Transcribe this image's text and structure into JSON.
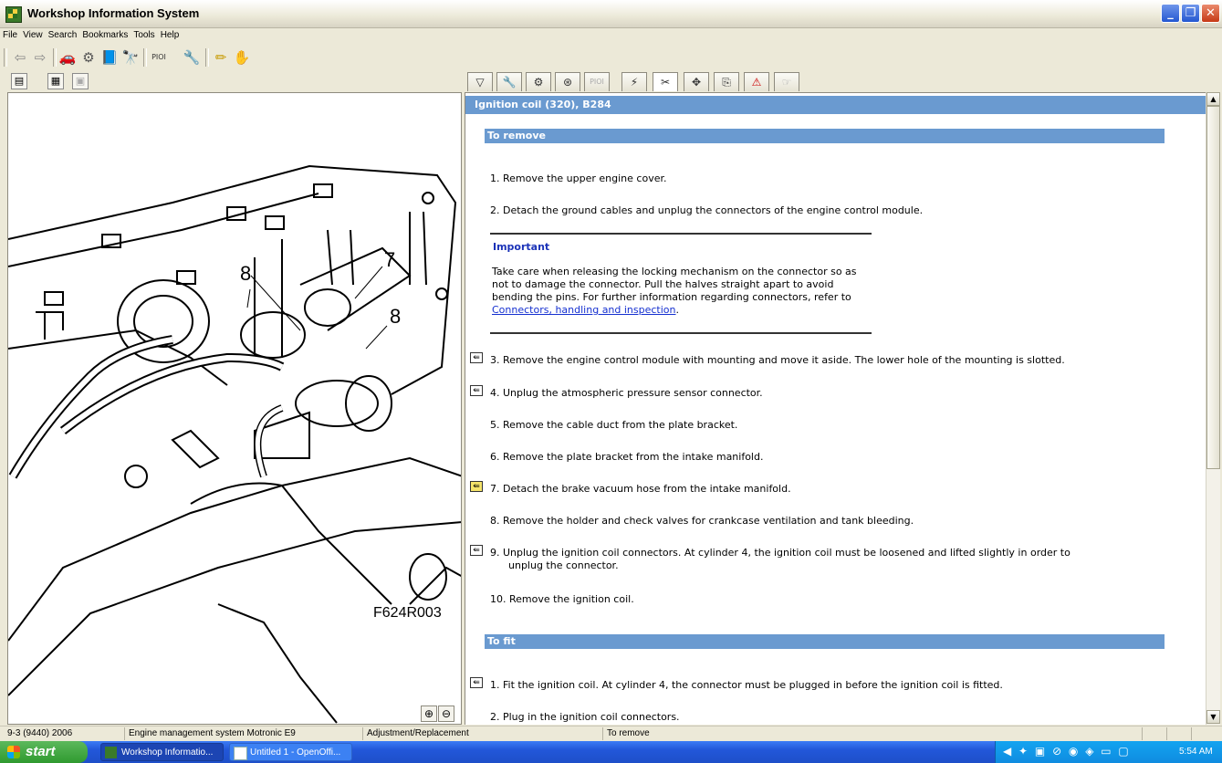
{
  "window": {
    "title": "Workshop Information System",
    "controls": {
      "minimize": "_",
      "maximize": "❐",
      "close": "✕"
    }
  },
  "menu": [
    "File",
    "View",
    "Search",
    "Bookmarks",
    "Tools",
    "Help"
  ],
  "toolbar": {
    "items": [
      "back-arrow-icon",
      "forward-arrow-icon",
      "car-icon",
      "chassis-icon",
      "book-icon",
      "binoculars-icon",
      "pi-icon",
      "wrench-tool-icon",
      "pencil-icon",
      "bell-icon"
    ],
    "pi_label": "PIOI"
  },
  "left_tabs": [
    "tree-view-icon",
    "document-view-icon",
    "image-view-icon"
  ],
  "right_tabs": [
    "triangle-icon",
    "wrench-icon",
    "engine-icon",
    "gear-icon",
    "pi-icon",
    "spark-icon",
    "tools-icon",
    "move-icon",
    "steps-icon",
    "warning-icon",
    "arrow-icon"
  ],
  "right_tabs_pi_label": "PIOI",
  "illustration": {
    "code": "F624R003",
    "callouts": [
      "8",
      "7",
      "8"
    ]
  },
  "zoom": {
    "in": "⊕",
    "out": "⊖"
  },
  "document": {
    "title": "Ignition coil (320), B284",
    "remove_heading": "To remove",
    "steps": [
      "1.  Remove the upper engine cover.",
      "2.  Detach the ground cables and unplug the connectors of the engine control module.",
      "3.  Remove the engine control module with mounting and move it aside. The lower hole of the mounting is slotted.",
      "4.  Unplug the atmospheric pressure sensor connector.",
      "5.  Remove the cable duct from the plate bracket.",
      "6.  Remove the plate bracket from the intake manifold.",
      "7.  Detach the brake vacuum hose from the intake manifold.",
      "8.  Remove the holder and check valves for crankcase ventilation and tank bleeding.",
      "9.  Unplug the ignition coil connectors. At cylinder 4, the ignition coil must be loosened and lifted slightly in order to",
      "unplug the connector.",
      "10. Remove the ignition coil."
    ],
    "important": {
      "title": "Important",
      "text": "Take care when releasing the locking mechanism on the connector so as not to damage the connector. Pull the halves straight apart to avoid bending the pins. For further information regarding connectors, refer to ",
      "link": "Connectors, handling and inspection",
      "after": "."
    },
    "fit_heading": "To fit",
    "fit_steps": [
      "1.  Fit the ignition coil. At cylinder 4, the connector must be plugged in before the ignition coil is fitted.",
      "2.  Plug in the ignition coil connectors."
    ]
  },
  "status": [
    "9-3 (9440) 2006",
    "Engine management system Motronic E9",
    "Adjustment/Replacement",
    "To remove"
  ],
  "taskbar": {
    "start": "start",
    "tasks": [
      "Workshop Informatio...",
      "Untitled 1 - OpenOffi..."
    ],
    "clock": "5:54 AM"
  }
}
